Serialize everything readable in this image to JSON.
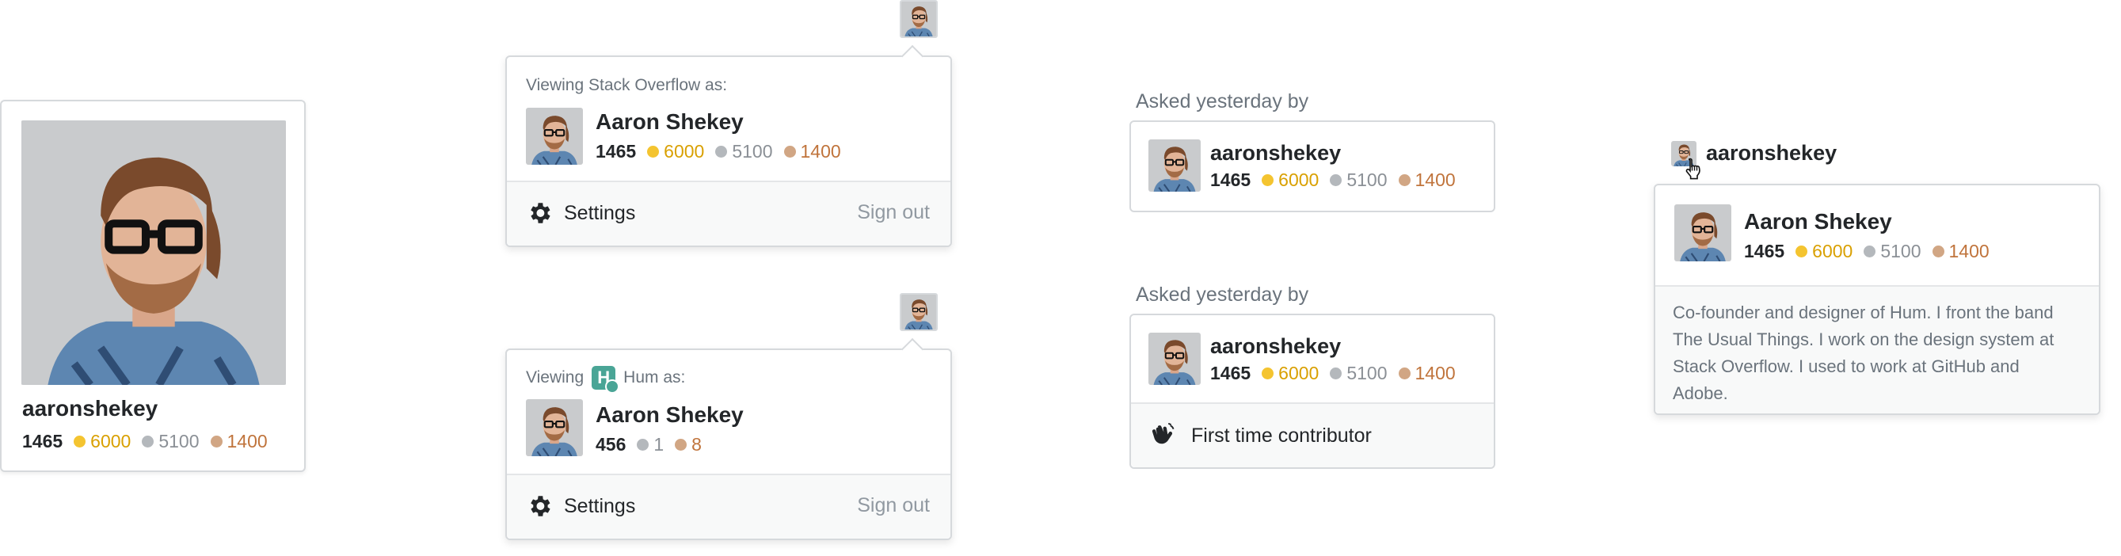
{
  "user": {
    "handle": "aaronshekey",
    "full_name": "Aaron Shekey",
    "rep": "1465",
    "gold": "6000",
    "silver": "5100",
    "bronze": "1400"
  },
  "profile_card": {
    "handle": "aaronshekey",
    "rep": "1465",
    "gold": "6000",
    "silver": "5100",
    "bronze": "1400"
  },
  "so_popover": {
    "viewing_label": "Viewing Stack Overflow as:",
    "name": "Aaron Shekey",
    "rep": "1465",
    "gold": "6000",
    "silver": "5100",
    "bronze": "1400",
    "settings_label": "Settings",
    "signout_label": "Sign out"
  },
  "hum_popover": {
    "viewing_prefix": "Viewing",
    "viewing_suffix": "Hum as:",
    "logo_letter": "H",
    "name": "Aaron Shekey",
    "rep": "456",
    "silver": "1",
    "bronze": "8",
    "settings_label": "Settings",
    "signout_label": "Sign out"
  },
  "asked_card_1": {
    "label": "Asked yesterday by",
    "handle": "aaronshekey",
    "rep": "1465",
    "gold": "6000",
    "silver": "5100",
    "bronze": "1400"
  },
  "asked_card_2": {
    "label": "Asked yesterday by",
    "handle": "aaronshekey",
    "rep": "1465",
    "gold": "6000",
    "silver": "5100",
    "bronze": "1400",
    "contributor_label": "First time contributor"
  },
  "hover_card": {
    "trigger_handle": "aaronshekey",
    "name": "Aaron Shekey",
    "rep": "1465",
    "gold": "6000",
    "silver": "5100",
    "bronze": "1400",
    "bio": "Co-founder and designer of Hum. I front the band The Usual Things. I work on the design system at Stack Overflow. I used to work at GitHub and Adobe."
  },
  "icons": {
    "gear": "gear-icon",
    "wave": "waving-hand-icon",
    "cursor": "hand-pointer-icon",
    "hum_logo": "hum-logo-icon"
  },
  "colors": {
    "gold": "#f4c430",
    "silver": "#b4b8bc",
    "bronze": "#d1a684",
    "hum_teal": "#4aa596"
  }
}
